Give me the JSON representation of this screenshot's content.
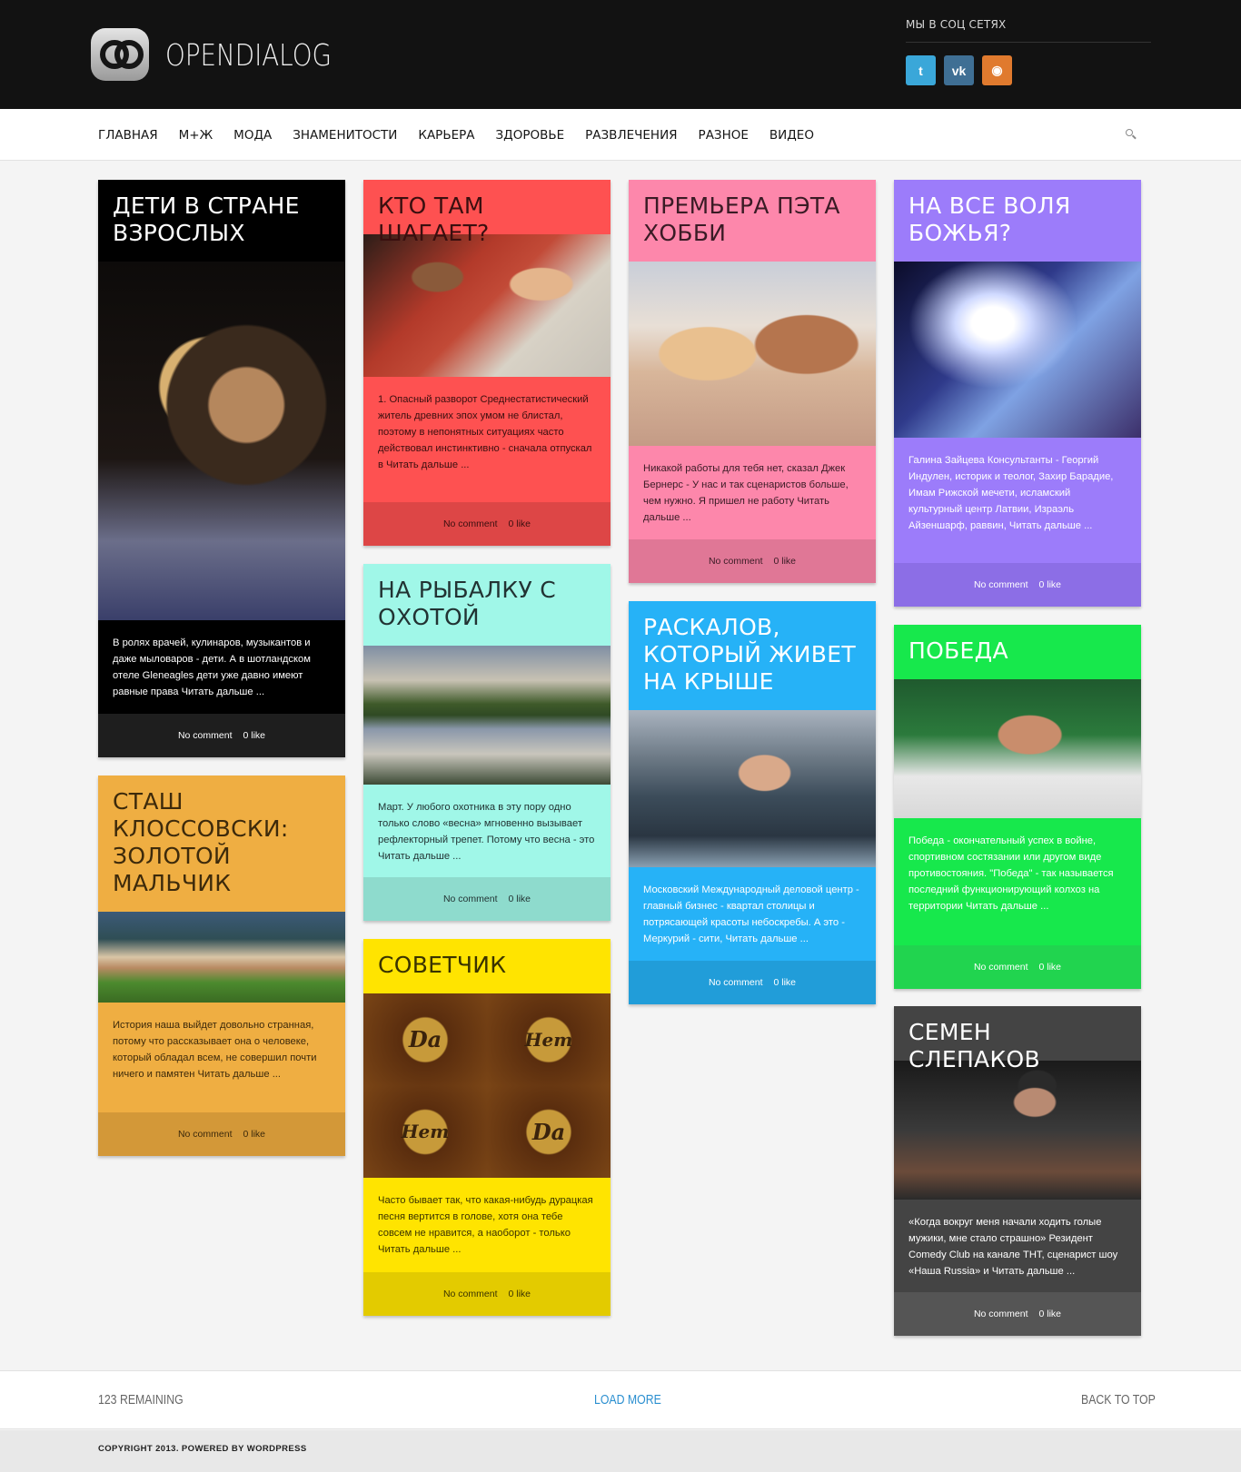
{
  "header": {
    "logo_text": "OPENDIALOG",
    "social_title": "МЫ В СОЦ СЕТЯХ",
    "social": [
      {
        "name": "twitter-icon",
        "glyph": "t"
      },
      {
        "name": "vk-icon",
        "glyph": "vk"
      },
      {
        "name": "rss-icon",
        "glyph": "◉"
      }
    ]
  },
  "nav": {
    "items": [
      "ГЛАВНАЯ",
      "М+Ж",
      "МОДА",
      "ЗНАМЕНИТОСТИ",
      "КАРЬЕРА",
      "ЗДОРОВЬЕ",
      "РАЗВЛЕЧЕНИЯ",
      "РАЗНОЕ",
      "ВИДЕО"
    ]
  },
  "cards": [
    {
      "id": "deti",
      "title": "ДЕТИ В СТРАНЕ ВЗРОСЛЫХ",
      "excerpt": "В ролях врачей, кулинаров, музыкантов и даже мыловаров - дети. А в шотландском отеле Gleneagles дети уже давно имеют равные права Читать дальше ...",
      "comments": "No comment",
      "likes": "0 like"
    },
    {
      "id": "shagaet",
      "title": "КТО ТАМ ШАГАЕТ?",
      "excerpt": "1. Опасный разворот Среднестатистический житель древних эпох умом не блистал, поэтому в непонятных ситуациях часто действовал инстинктивно - сначала отпускал в Читать дальше ...",
      "comments": "No comment",
      "likes": "0 like"
    },
    {
      "id": "premiera",
      "title": "ПРЕМЬЕРА ПЭТА ХОББИ",
      "excerpt": "Никакой работы для тебя нет, сказал Джек Бернерс - У нас и так сценаристов больше, чем нужно. Я пришел не работу Читать дальше ...",
      "comments": "No comment",
      "likes": "0 like"
    },
    {
      "id": "volya",
      "title": "НА ВСЕ ВОЛЯ БОЖЬЯ?",
      "excerpt": "Галина Зайцева Консультанты - Георгий Индулен, историк и теолог, Захир Барадие, Имам Рижской мечети, исламский культурный центр Латвии, Израэль Айзеншарф, раввин, Читать дальше ...",
      "comments": "No comment",
      "likes": "0 like"
    },
    {
      "id": "stash",
      "title": "СТАШ КЛОССОВСКИ: ЗОЛОТОЙ МАЛЬЧИК",
      "excerpt": "История наша выйдет довольно странная, потому что рассказывает она о человеке, который обладал всем, не совершил почти ничего и памятен Читать дальше ...",
      "comments": "No comment",
      "likes": "0 like"
    },
    {
      "id": "rybalka",
      "title": "НА РЫБАЛКУ С ОХОТОЙ",
      "excerpt": "Март. У любого охотника в эту пору одно только слово «весна» мгновенно вызывает рефлекторный трепет. Потому что весна - это Читать дальше ...",
      "comments": "No comment",
      "likes": "0 like"
    },
    {
      "id": "raskalov",
      "title": "РАСКАЛОВ, КОТОРЫЙ ЖИВЕТ НА КРЫШЕ",
      "excerpt": "Московский Международный деловой центр - главный бизнес - квартал столицы и потрясающей красоты небоскребы. А это - Меркурий - сити, Читать дальше ...",
      "comments": "No comment",
      "likes": "0 like"
    },
    {
      "id": "pobeda",
      "title": "ПОБЕДА",
      "excerpt": "Победа - окончательный успех в войне, спортивном состязании или другом виде противостояния. \"Победа\" - так называется последний функционирующий колхоз на территории Читать дальше ...",
      "comments": "No comment",
      "likes": "0 like"
    },
    {
      "id": "sovetchik",
      "title": "СОВЕТЧИК",
      "excerpt": "Часто бывает так, что какая-нибудь дурацкая песня вертится в голове, хотя она тебе совсем не нравится, а наоборот - только Читать дальше ...",
      "comments": "No comment",
      "likes": "0 like",
      "coin_words": [
        "Da",
        "Hem",
        "Hem",
        "Da"
      ]
    },
    {
      "id": "slepakov",
      "title": "СЕМЕН СЛЕПАКОВ",
      "excerpt": "«Когда вокруг меня начали ходить голые мужики, мне стало страшно» Резидент Comedy Club на канале ТНТ, сценарист шоу «Наша Russia» и Читать дальше ...",
      "comments": "No comment",
      "likes": "0 like"
    }
  ],
  "footer": {
    "remaining": "123 REMAINING",
    "load_more": "LOAD MORE",
    "back_to_top": "BACK TO TOP",
    "copyright": "COPYRIGHT 2013. POWERED BY WORDPRESS"
  }
}
